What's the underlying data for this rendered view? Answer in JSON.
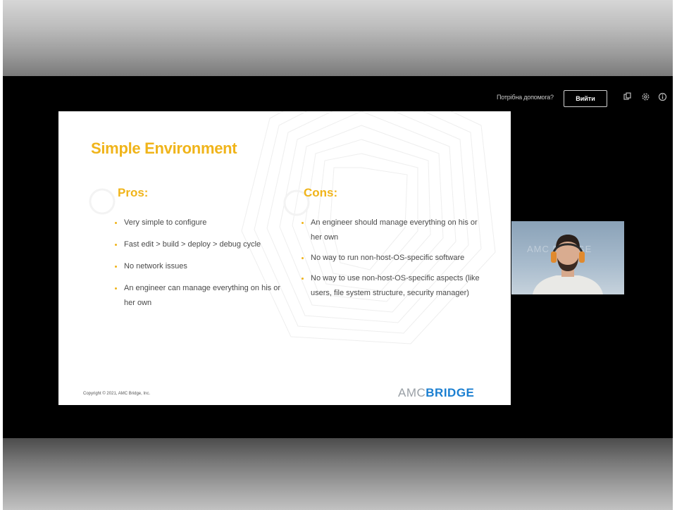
{
  "topbar": {
    "help_link": "Потрібна допомога?",
    "login_label": "Вийти",
    "icons": [
      "share-icon",
      "settings-icon",
      "info-icon"
    ]
  },
  "slide": {
    "title": "Simple Environment",
    "pros": {
      "heading": "Pros:",
      "items": [
        "Very simple to configure",
        "Fast edit > build > deploy > debug cycle",
        "No network issues",
        "An engineer can manage everything on his or her own"
      ]
    },
    "cons": {
      "heading": "Cons:",
      "items": [
        "An engineer should manage everything on his or her own",
        "No way to run non-host-OS-specific software",
        "No way to use non-host-OS-specific aspects (like users, file system structure, security manager)"
      ]
    },
    "copyright": "Copyright © 2021, AMC Bridge, Inc.",
    "logo": {
      "left": "AMC",
      "right": "BRIDGE"
    }
  },
  "video": {
    "watermark": "AMC BRIDGE"
  },
  "colors": {
    "accent": "#f0b41a",
    "logo_blue": "#1b7fd1",
    "app_background": "#000000"
  }
}
